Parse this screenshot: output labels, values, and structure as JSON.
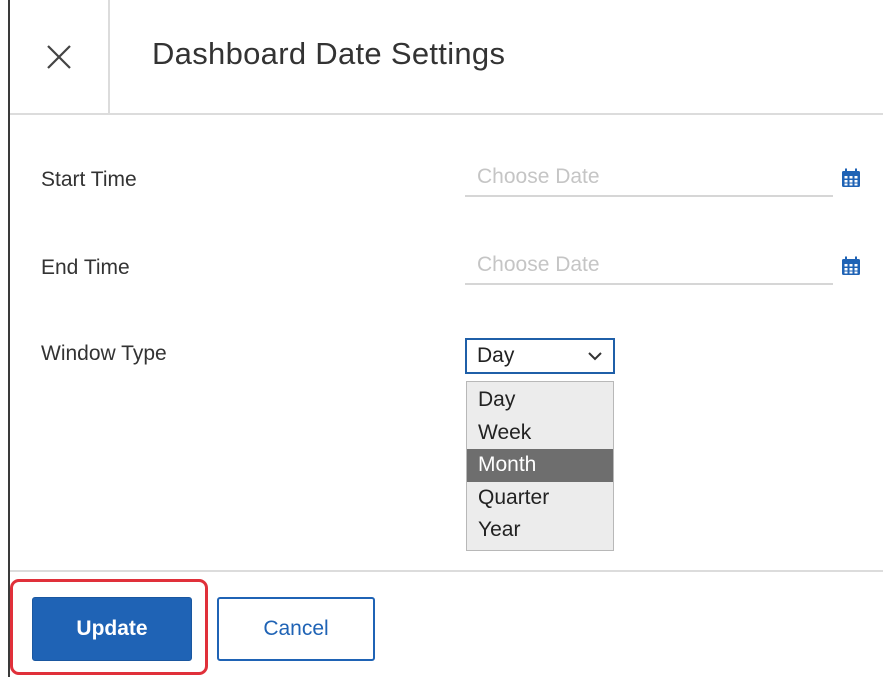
{
  "dialog": {
    "title": "Dashboard Date Settings",
    "close_icon": "close-icon"
  },
  "form": {
    "start_time": {
      "label": "Start Time",
      "placeholder": "Choose Date",
      "value": "",
      "icon": "calendar-icon"
    },
    "end_time": {
      "label": "End Time",
      "placeholder": "Choose Date",
      "value": "",
      "icon": "calendar-icon"
    },
    "window_type": {
      "label": "Window Type",
      "selected": "Day",
      "options": [
        "Day",
        "Week",
        "Month",
        "Quarter",
        "Year"
      ],
      "highlighted_option": "Month",
      "icon": "chevron-down-icon"
    }
  },
  "footer": {
    "update_label": "Update",
    "cancel_label": "Cancel"
  },
  "colors": {
    "primary": "#1f63b5",
    "highlight_border": "#e0303a",
    "option_highlight": "#6e6e6e",
    "calendar_icon": "#1f63b5"
  }
}
